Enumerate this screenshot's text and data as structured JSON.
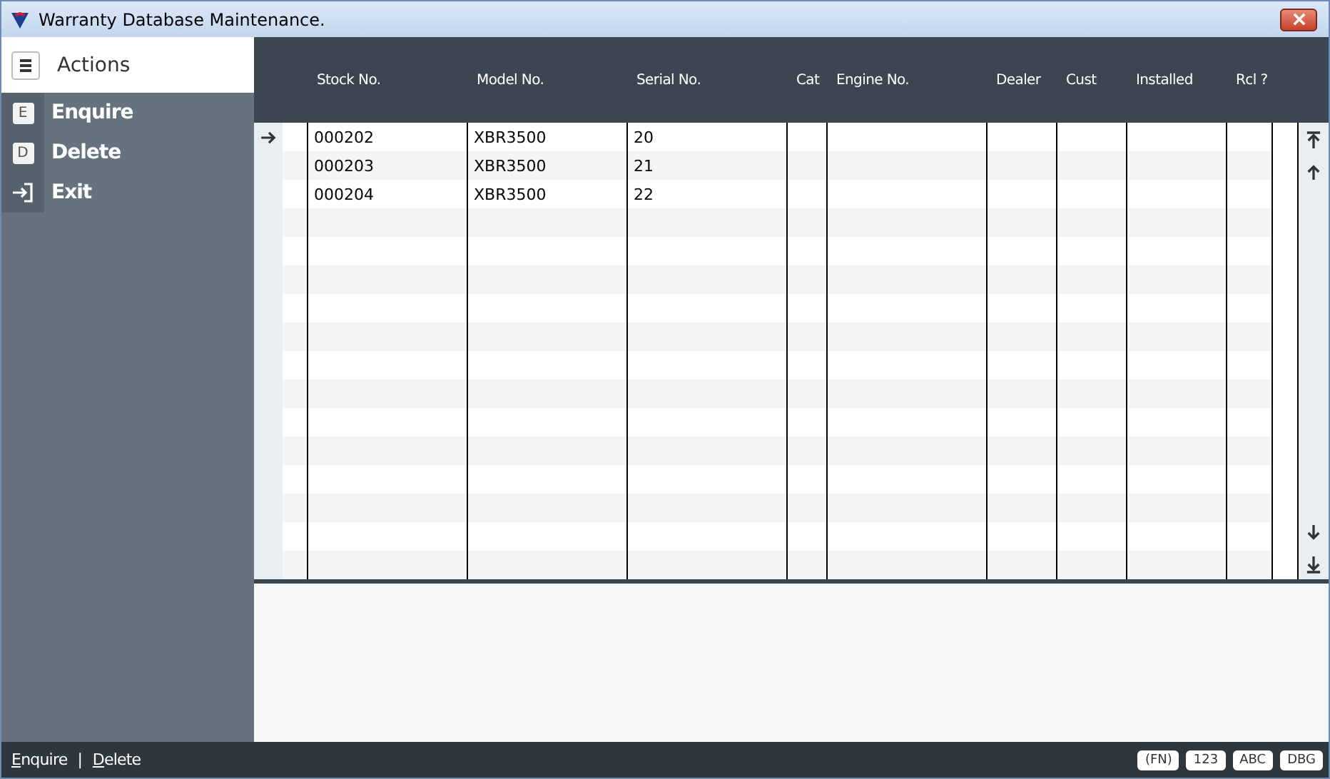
{
  "window": {
    "title": "Warranty Database Maintenance."
  },
  "sidebar": {
    "title": "Actions",
    "items": [
      {
        "key": "E",
        "label": "Enquire",
        "kind": "letter"
      },
      {
        "key": "D",
        "label": "Delete",
        "kind": "letter"
      },
      {
        "label": "Exit",
        "kind": "exit"
      }
    ]
  },
  "table": {
    "columns": [
      "Stock No.",
      "Model No.",
      "Serial No.",
      "Cat",
      "Engine No.",
      "Dealer",
      "Cust",
      "Installed",
      "Rcl ?"
    ],
    "rows": [
      {
        "current": true,
        "cells": [
          "000202",
          "XBR3500",
          "20",
          "",
          "",
          "",
          "",
          "",
          ""
        ]
      },
      {
        "current": false,
        "cells": [
          "000203",
          "XBR3500",
          "21",
          "",
          "",
          "",
          "",
          "",
          ""
        ]
      },
      {
        "current": false,
        "cells": [
          "000204",
          "XBR3500",
          "22",
          "",
          "",
          "",
          "",
          "",
          ""
        ]
      }
    ]
  },
  "status_bar": {
    "links": [
      "Enquire",
      "Delete"
    ],
    "separator": "|",
    "indicators": [
      "(FN)",
      "123",
      "ABC",
      "DBG"
    ]
  }
}
